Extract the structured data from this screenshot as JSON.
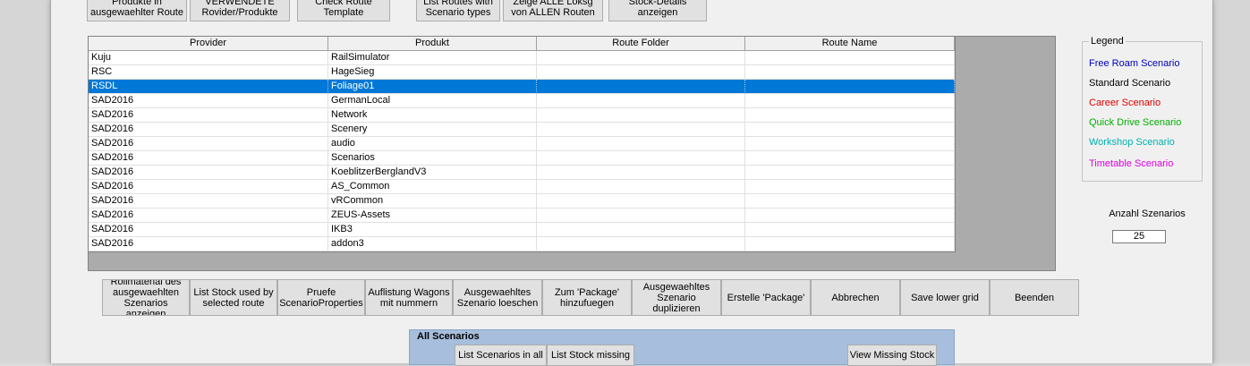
{
  "top_buttons": [
    {
      "label": "Produkte in\nausgewaehlter Route"
    },
    {
      "label": "VERWENDETE\nRovider/Produkte"
    },
    {
      "label": "Check Route\nTemplate"
    },
    {
      "label": "List Routes with\nScenario types"
    },
    {
      "label": "Zeige ALLE Loksg\nvon ALLEN Routen"
    },
    {
      "label": "Stock-Details\nanzeigen"
    }
  ],
  "grid": {
    "columns": [
      "Provider",
      "Produkt",
      "Route Folder",
      "Route Name"
    ],
    "rows": [
      {
        "provider": "Kuju",
        "produkt": "RailSimulator",
        "route_folder": "",
        "route_name": ""
      },
      {
        "provider": "RSC",
        "produkt": "HageSieg",
        "route_folder": "",
        "route_name": ""
      },
      {
        "provider": "RSDL",
        "produkt": "Foliage01",
        "route_folder": "",
        "route_name": ""
      },
      {
        "provider": "SAD2016",
        "produkt": "GermanLocal",
        "route_folder": "",
        "route_name": ""
      },
      {
        "provider": "SAD2016",
        "produkt": "Network",
        "route_folder": "",
        "route_name": ""
      },
      {
        "provider": "SAD2016",
        "produkt": "Scenery",
        "route_folder": "",
        "route_name": ""
      },
      {
        "provider": "SAD2016",
        "produkt": "audio",
        "route_folder": "",
        "route_name": ""
      },
      {
        "provider": "SAD2016",
        "produkt": "Scenarios",
        "route_folder": "",
        "route_name": ""
      },
      {
        "provider": "SAD2016",
        "produkt": "KoeblitzerBerglandV3",
        "route_folder": "",
        "route_name": ""
      },
      {
        "provider": "SAD2016",
        "produkt": "AS_Common",
        "route_folder": "",
        "route_name": ""
      },
      {
        "provider": "SAD2016",
        "produkt": "vRCommon",
        "route_folder": "",
        "route_name": ""
      },
      {
        "provider": "SAD2016",
        "produkt": "ZEUS-Assets",
        "route_folder": "",
        "route_name": ""
      },
      {
        "provider": "SAD2016",
        "produkt": "IKB3",
        "route_folder": "",
        "route_name": ""
      },
      {
        "provider": "SAD2016",
        "produkt": "addon3",
        "route_folder": "",
        "route_name": ""
      }
    ],
    "selected_row": 2,
    "selection_color": "#0078d7"
  },
  "legend": {
    "title": "Legend",
    "items": [
      {
        "label": "Free Roam Scenario",
        "color": "#0000c0"
      },
      {
        "label": "Standard Scenario",
        "color": "#000000"
      },
      {
        "label": "Career Scenario",
        "color": "#e00000"
      },
      {
        "label": "Quick Drive Scenario",
        "color": "#00b000"
      },
      {
        "label": "Workshop Scenario",
        "color": "#00b0b0"
      },
      {
        "label": "Timetable Scenario",
        "color": "#e000e0"
      }
    ]
  },
  "anzahl": {
    "label": "Anzahl Szenarios",
    "value": "25"
  },
  "action_buttons": [
    {
      "label": "Rollmaterial des\nausgewaehlten\nSzenarios anzeigen"
    },
    {
      "label": "List Stock used by\nselected route"
    },
    {
      "label": "Pruefe\nScenarioProperties"
    },
    {
      "label": "Auflistung Wagons\nmit nummern"
    },
    {
      "label": "Ausgewaehltes\nSzenario loeschen"
    },
    {
      "label": "Zum 'Package'\nhinzufuegen"
    },
    {
      "label": "Ausgewaehltes\nSzenario\nduplizieren"
    },
    {
      "label": "Erstelle 'Package'"
    },
    {
      "label": "Abbrechen"
    },
    {
      "label": "Save lower grid"
    },
    {
      "label": "Beenden"
    }
  ],
  "all_scenarios": {
    "title": "All Scenarios",
    "buttons": [
      "List Scenarios in all",
      "List Stock missing",
      "View Missing Stock"
    ],
    "background": "#a7bedc"
  }
}
